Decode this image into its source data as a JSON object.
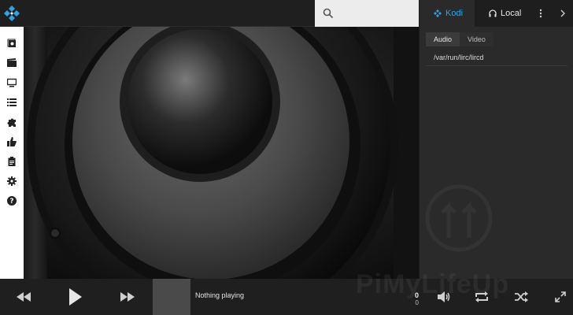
{
  "app": {
    "brand_color": "#2ea3e6",
    "logo_icon": "kodi-logo-icon"
  },
  "search": {
    "icon": "search-icon"
  },
  "leftnav": {
    "items": [
      {
        "icon": "music-library-icon"
      },
      {
        "icon": "movies-icon"
      },
      {
        "icon": "tv-icon"
      },
      {
        "icon": "playlist-icon"
      },
      {
        "icon": "addons-icon"
      },
      {
        "icon": "thumbs-up-icon"
      },
      {
        "icon": "clipboard-icon"
      },
      {
        "icon": "settings-icon"
      },
      {
        "icon": "help-icon"
      }
    ]
  },
  "right_panel": {
    "tabs": [
      {
        "label": "Kodi",
        "icon": "kodi-icon"
      },
      {
        "label": "Local",
        "icon": "headphones-icon"
      }
    ],
    "more_icon": "vertical-dots-icon",
    "next_icon": "chevron-right-icon",
    "subtabs": [
      "Audio",
      "Video"
    ],
    "devices": [
      "/var/run/lirc/lircd"
    ]
  },
  "player": {
    "now_playing": "Nothing playing",
    "counter_top": "0",
    "counter_bottom": "0",
    "icons": [
      "rewind-icon",
      "play-icon",
      "fast-forward-icon",
      "volume-icon",
      "repeat-icon",
      "shuffle-icon",
      "expand-icon"
    ]
  },
  "watermark": "PiMyLifeUp"
}
